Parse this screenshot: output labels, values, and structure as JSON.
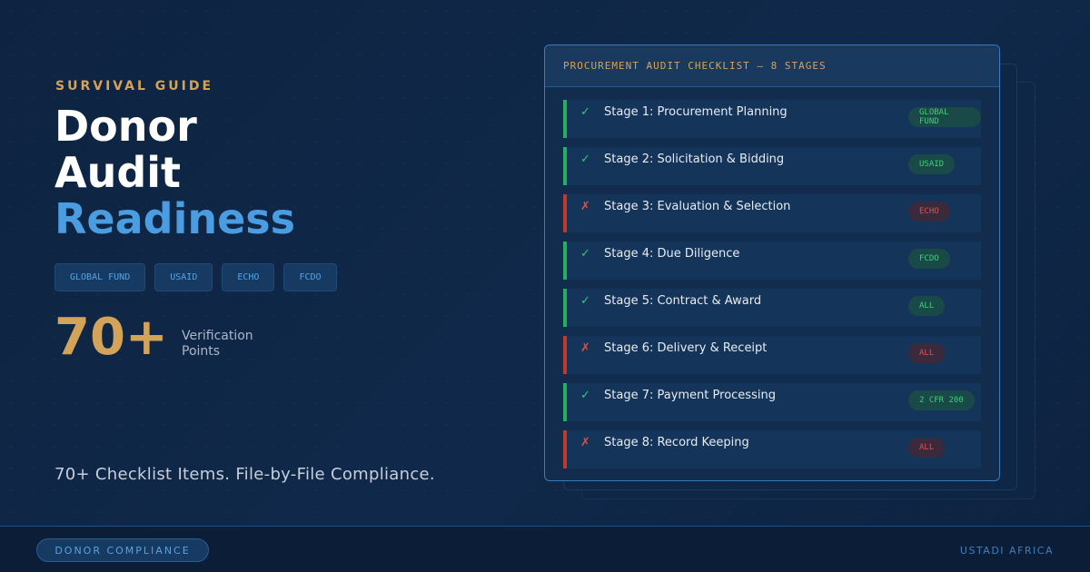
{
  "eyebrow": "SURVIVAL GUIDE",
  "title": {
    "line1": "Donor",
    "line2": "Audit",
    "line3": "Readiness"
  },
  "donor_tags": [
    "GLOBAL FUND",
    "USAID",
    "ECHO",
    "FCDO"
  ],
  "stat": {
    "value": "70+",
    "label": "Verification Points"
  },
  "tagline": "70+ Checklist Items. File-by-File Compliance.",
  "checklist": {
    "header": "PROCUREMENT AUDIT CHECKLIST — 8 STAGES",
    "stages": [
      {
        "label": "Stage 1: Procurement Planning",
        "badge": "GLOBAL FUND",
        "mark": "✓",
        "status": "pass"
      },
      {
        "label": "Stage 2: Solicitation & Bidding",
        "badge": "USAID",
        "mark": "✓",
        "status": "pass"
      },
      {
        "label": "Stage 3: Evaluation & Selection",
        "badge": "ECHO",
        "mark": "✗",
        "status": "fail"
      },
      {
        "label": "Stage 4: Due Diligence",
        "badge": "FCDO",
        "mark": "✓",
        "status": "pass"
      },
      {
        "label": "Stage 5: Contract & Award",
        "badge": "ALL",
        "mark": "✓",
        "status": "pass"
      },
      {
        "label": "Stage 6: Delivery & Receipt",
        "badge": "ALL",
        "mark": "✗",
        "status": "fail"
      },
      {
        "label": "Stage 7: Payment Processing",
        "badge": "2 CFR 200",
        "mark": "✓",
        "status": "pass"
      },
      {
        "label": "Stage 8: Record Keeping",
        "badge": "ALL",
        "mark": "✗",
        "status": "fail"
      }
    ]
  },
  "footer": {
    "pill": "DONOR COMPLIANCE",
    "brand": "USTADI AFRICA"
  },
  "colors": {
    "accent_gold": "#d4a35a",
    "accent_blue": "#4a9de0",
    "pass": "#27ae60",
    "fail": "#c0392b"
  }
}
